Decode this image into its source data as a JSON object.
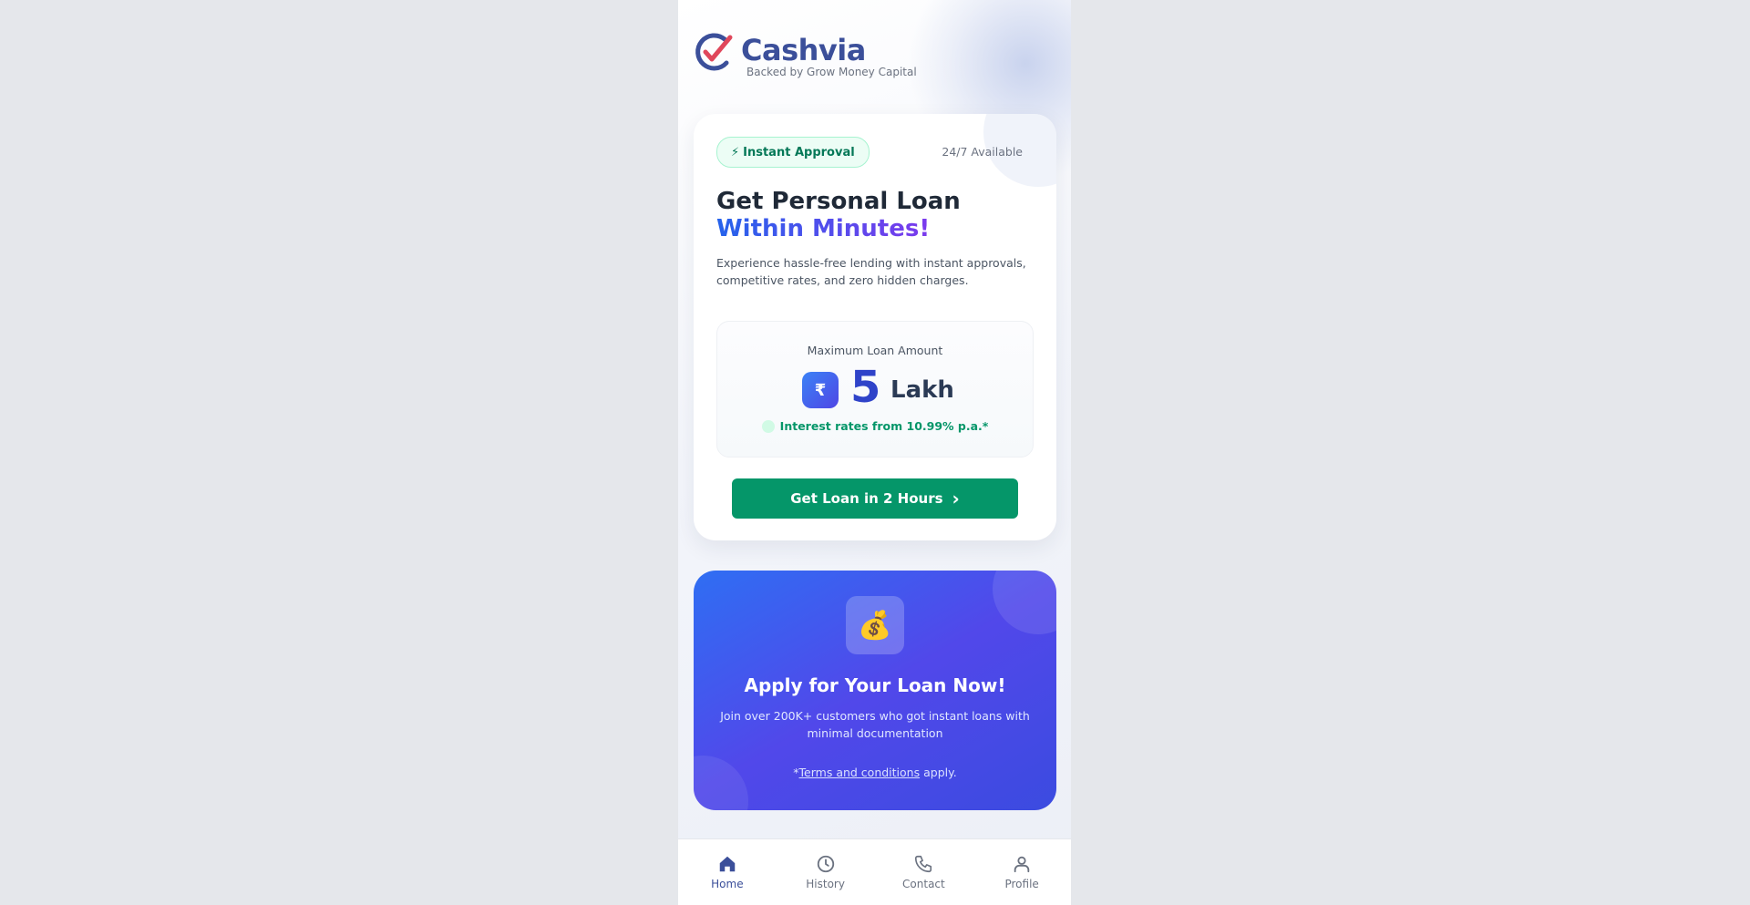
{
  "brand": {
    "name": "Cashvia",
    "tagline": "Backed by Grow Money Capital"
  },
  "hero": {
    "badge": "Instant Approval",
    "badge_icon": "⚡",
    "availability": "24/7 Available",
    "title_line1": "Get Personal Loan",
    "title_line2": "Within Minutes!",
    "description": "Experience hassle-free lending with instant approvals, competitive rates, and zero hidden charges."
  },
  "amount": {
    "label": "Maximum Loan Amount",
    "currency_symbol": "₹",
    "value": "5",
    "unit": "Lakh",
    "rate_text": "Interest rates from 10.99% p.a.*"
  },
  "cta": {
    "label": "Get Loan in 2 Hours",
    "arrow": "›"
  },
  "promo": {
    "icon": "💰",
    "title": "Apply for Your Loan Now!",
    "description": "Join over 200K+ customers who got instant loans with minimal documentation",
    "terms_prefix": "*",
    "terms_link": "Terms and conditions",
    "terms_suffix": " apply."
  },
  "nav": {
    "items": [
      {
        "label": "Home",
        "icon": "home-icon",
        "active": true
      },
      {
        "label": "History",
        "icon": "clock-icon",
        "active": false
      },
      {
        "label": "Contact",
        "icon": "phone-icon",
        "active": false
      },
      {
        "label": "Profile",
        "icon": "user-icon",
        "active": false
      }
    ]
  },
  "colors": {
    "primary": "#3b4f9a",
    "success": "#059669",
    "promo_bg": "#4f46e5"
  }
}
